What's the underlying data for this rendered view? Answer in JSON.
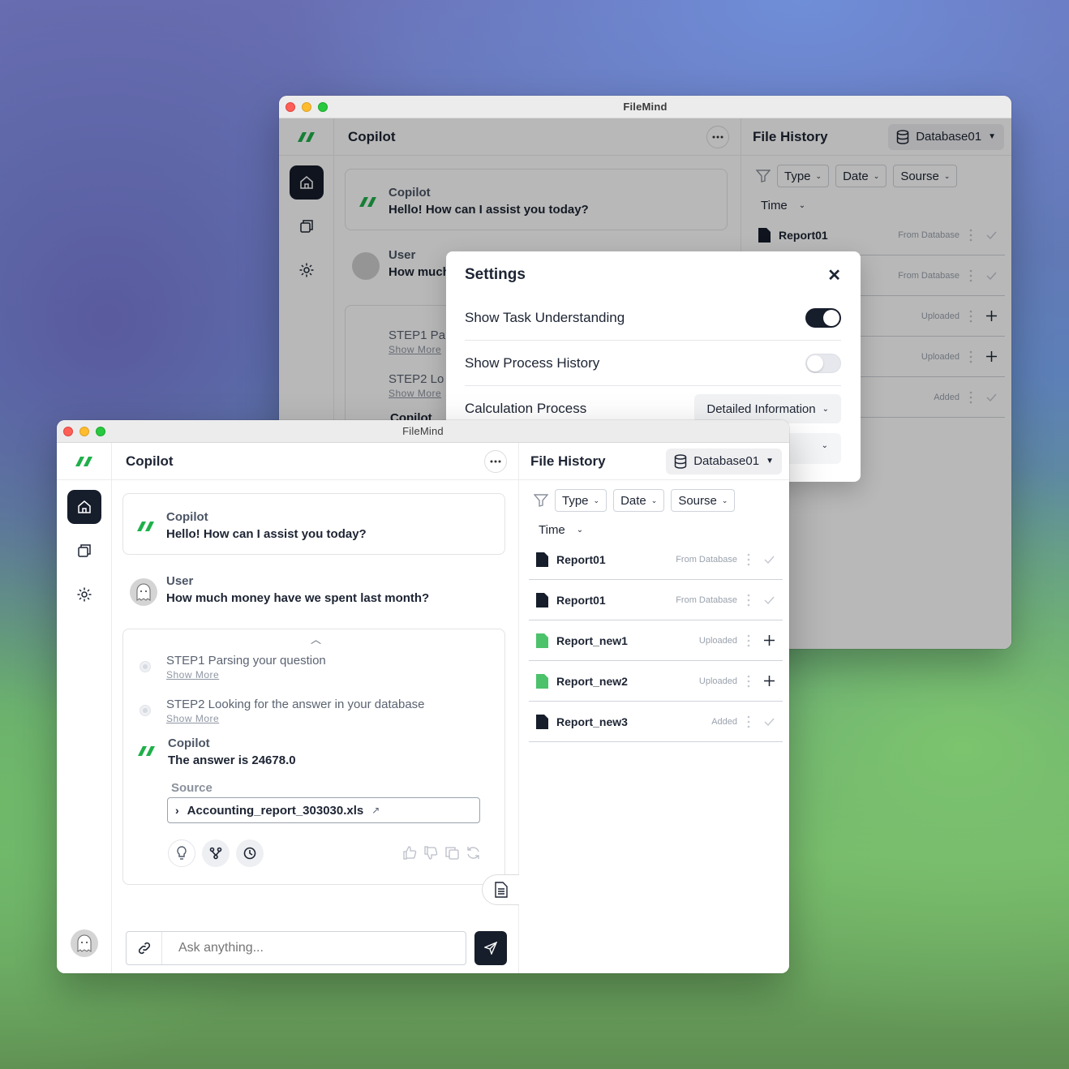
{
  "window": {
    "title": "FileMind"
  },
  "chat": {
    "header_title": "Copilot",
    "greeting": {
      "sender": "Copilot",
      "text": "Hello! How can I assist you today?"
    },
    "user": {
      "sender": "User",
      "text": "How much money have we spent last month?"
    },
    "steps": [
      {
        "title": "STEP1 Parsing your question",
        "more": "Show More"
      },
      {
        "title": "STEP2 Looking for the answer in your database",
        "more": "Show More"
      }
    ],
    "answer": {
      "sender": "Copilot",
      "text": "The answer is 24678.0"
    },
    "source_label": "Source",
    "source_file": "Accounting_report_303030.xls",
    "input_placeholder": "Ask anything..."
  },
  "back_chat": {
    "user_text_partial": "How much",
    "step1_partial": "STEP1 Par",
    "step2_partial": "STEP2 Lo",
    "copilot_partial": "Copilot"
  },
  "history": {
    "title": "File History",
    "database": "Database01",
    "filters": [
      "Type",
      "Date",
      "Sourse"
    ],
    "sort_label": "Time",
    "files": [
      {
        "name": "Report01",
        "status": "From Database",
        "action": "check",
        "color": "#161d2b"
      },
      {
        "name": "Report01",
        "status": "From Database",
        "action": "check",
        "color": "#161d2b"
      },
      {
        "name": "Report_new1",
        "status": "Uploaded",
        "action": "plus",
        "color": "#4cc26a"
      },
      {
        "name": "Report_new2",
        "status": "Uploaded",
        "action": "plus",
        "color": "#4cc26a"
      },
      {
        "name": "Report_new3",
        "status": "Added",
        "action": "check",
        "color": "#161d2b"
      }
    ]
  },
  "settings": {
    "title": "Settings",
    "rows": [
      {
        "label": "Show Task Understanding",
        "toggle": true
      },
      {
        "label": "Show Process History",
        "toggle": false
      },
      {
        "label": "Calculation Process",
        "select": "Detailed Information"
      }
    ]
  },
  "colors": {
    "accent_dark": "#161d2b",
    "brand_green": "#1fb04a",
    "file_green": "#4cc26a"
  }
}
